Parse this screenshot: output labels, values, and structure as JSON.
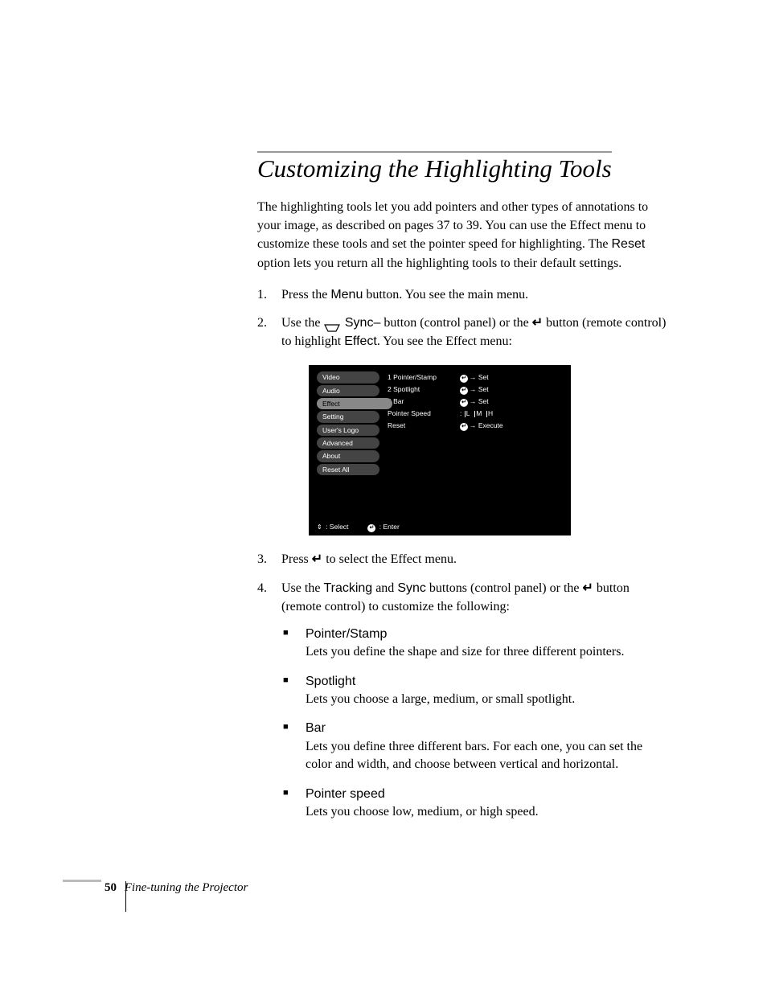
{
  "heading": "Customizing the Highlighting Tools",
  "intro": "The highlighting tools let you add pointers and other types of annotations to your image, as described on pages 37 to 39. You can use the Effect menu to customize these tools and set the pointer speed for highlighting. The ",
  "intro_reset": "Reset",
  "intro_tail": " option lets you return all the highlighting tools to their default settings.",
  "step1_a": "Press the ",
  "step1_menu": "Menu",
  "step1_b": " button. You see the main menu.",
  "step2_a": "Use the ",
  "step2_sync": " Sync–",
  "step2_b": " button (control panel) or the ",
  "step2_c": " button (remote control) to highlight ",
  "step2_effect": "Effect",
  "step2_d": ". You see the Effect menu:",
  "menu": {
    "left": [
      "Video",
      "Audio",
      "Effect",
      "Setting",
      "User's Logo",
      "Advanced",
      "About",
      "Reset All"
    ],
    "right": [
      {
        "label": "1  Pointer/Stamp",
        "action": "Set",
        "type": "enter"
      },
      {
        "label": "2  Spotlight",
        "action": "Set",
        "type": "enter"
      },
      {
        "label": "3  Bar",
        "action": "Set",
        "type": "enter"
      },
      {
        "label": "Pointer Speed",
        "action": ": L   M   H",
        "type": "ticks"
      },
      {
        "label": "Reset",
        "action": "Execute",
        "type": "enter"
      }
    ],
    "footer_select": " : Select",
    "footer_enter": " : Enter"
  },
  "step3_a": "Press ",
  "step3_b": " to select the Effect menu.",
  "step4_a": "Use the ",
  "step4_tracking": "Tracking",
  "step4_b": " and ",
  "step4_sync": "Sync",
  "step4_c": " buttons (control panel) or the ",
  "step4_d": " button (remote control) to customize the following:",
  "sub": [
    {
      "head": "Pointer/Stamp",
      "body": "Lets you define the shape and size for three different pointers."
    },
    {
      "head": "Spotlight",
      "body": "Lets you choose a large, medium, or small spotlight."
    },
    {
      "head": "Bar",
      "body": "Lets you define three different bars. For each one, you can set the color and width, and choose between vertical and horizontal."
    },
    {
      "head": "Pointer speed",
      "body": "Lets you choose low, medium, or high speed."
    }
  ],
  "footer": {
    "page": "50",
    "section": "Fine-tuning the Projector"
  }
}
